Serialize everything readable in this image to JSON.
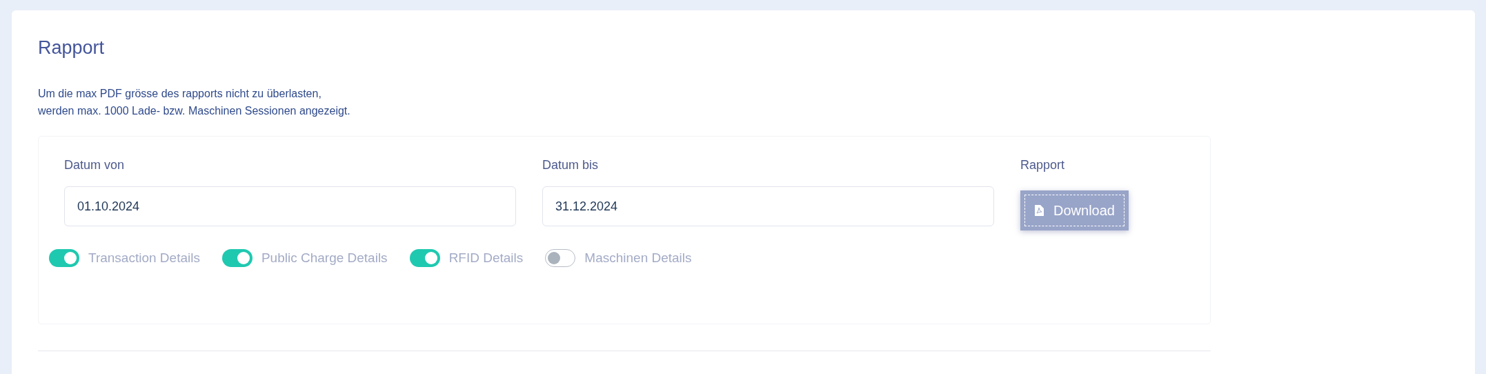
{
  "title": "Rapport",
  "description": [
    "Um die max PDF grösse des rapports nicht zu überlasten,",
    "werden max. 1000 Lade- bzw. Maschinen Sessionen angezeigt."
  ],
  "fields": [
    {
      "label": "Datum von",
      "value": "01.10.2024"
    },
    {
      "label": "Datum bis",
      "value": "31.12.2024"
    }
  ],
  "report": {
    "label": "Rapport",
    "button": "Download"
  },
  "toggles": [
    {
      "label": "Transaction Details",
      "on": true
    },
    {
      "label": "Public Charge Details",
      "on": true
    },
    {
      "label": "RFID Details",
      "on": true
    },
    {
      "label": "Maschinen Details",
      "on": false
    }
  ]
}
